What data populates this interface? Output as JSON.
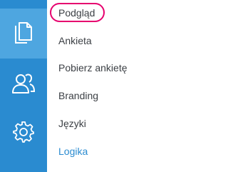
{
  "rail": {
    "items": [
      {
        "icon": "documents-icon",
        "active": true
      },
      {
        "icon": "users-icon",
        "active": false
      },
      {
        "icon": "gear-icon",
        "active": false
      }
    ],
    "color": "#2a8bd0",
    "active_color": "#4ea6e0"
  },
  "menu": {
    "items": [
      {
        "label": "Podgląd",
        "highlighted": true
      },
      {
        "label": "Ankieta"
      },
      {
        "label": "Pobierz ankietę"
      },
      {
        "label": "Branding"
      },
      {
        "label": "Języki"
      },
      {
        "label": "Logika",
        "link": true
      }
    ],
    "text_color": "#3b3f44",
    "link_color": "#2a8bd0",
    "highlight_color": "#e6006e"
  }
}
